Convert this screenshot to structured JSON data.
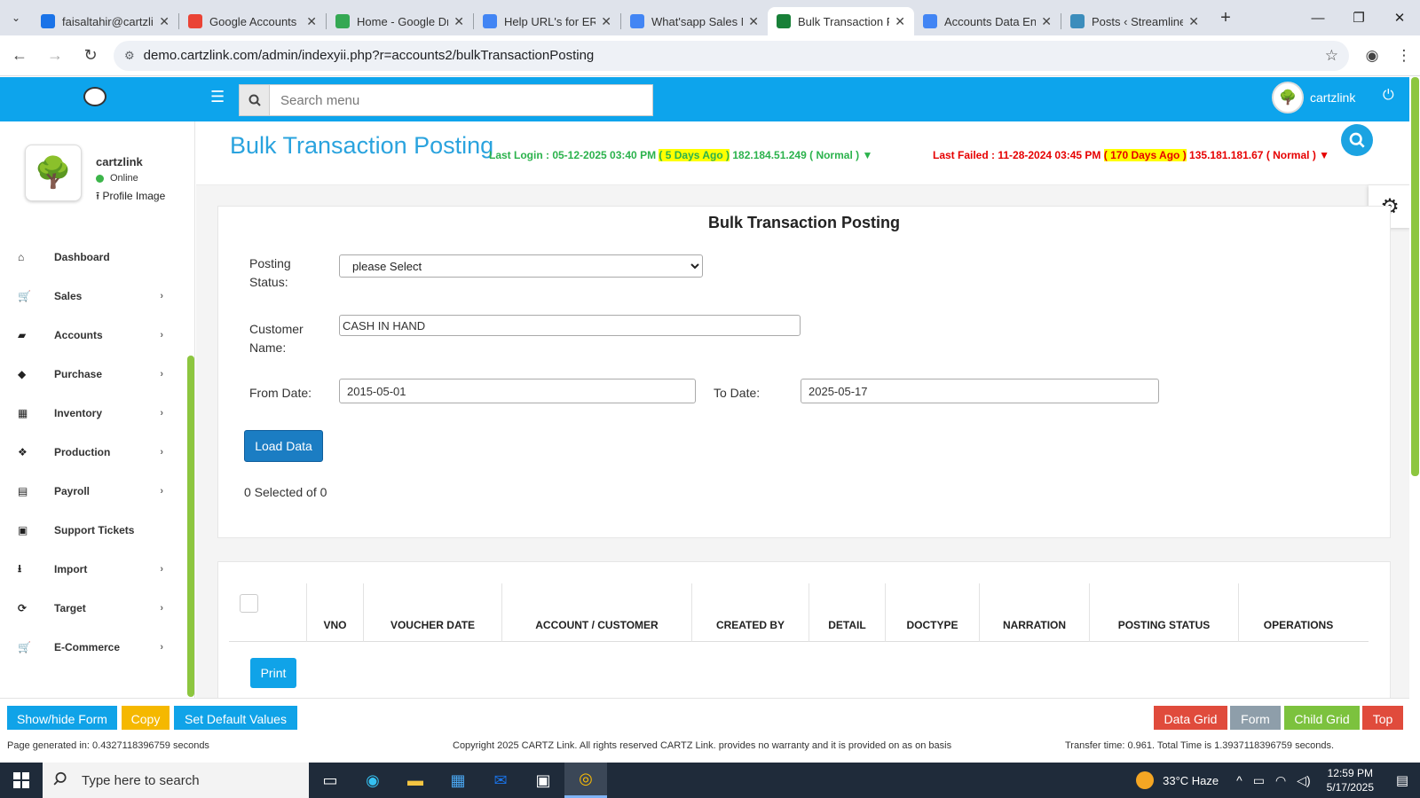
{
  "browser": {
    "tabs": [
      {
        "title": "faisaltahir@cartzli",
        "icon": "gmail-icon",
        "color": "#1a73e8"
      },
      {
        "title": "Google Accounts",
        "icon": "google-icon",
        "color": "#ea4335"
      },
      {
        "title": "Home - Google Dr",
        "icon": "drive-icon",
        "color": "#34a853"
      },
      {
        "title": "Help URL's for ERP",
        "icon": "docs-icon",
        "color": "#4285f4"
      },
      {
        "title": "What'sapp Sales M",
        "icon": "docs-icon",
        "color": "#4285f4"
      },
      {
        "title": "Bulk Transaction P",
        "icon": "sitemap-icon",
        "color": "#188038",
        "active": true
      },
      {
        "title": "Accounts Data Ent",
        "icon": "docs-icon",
        "color": "#4285f4"
      },
      {
        "title": "Posts ‹ Streamline",
        "icon": "wordpress-icon",
        "color": "#3c8dbc"
      }
    ],
    "url": "demo.cartzlink.com/admin/indexyii.php?r=accounts2/bulkTransactionPosting"
  },
  "header": {
    "search_placeholder": "Search menu",
    "username": "cartzlink"
  },
  "sidebar": {
    "profile_name": "cartzlink",
    "status": "Online",
    "profile_image_label": "Profile Image",
    "items": [
      {
        "label": "Dashboard",
        "icon": "home-icon",
        "has_children": false
      },
      {
        "label": "Sales",
        "icon": "cart-icon",
        "has_children": true
      },
      {
        "label": "Accounts",
        "icon": "briefcase-icon",
        "has_children": true
      },
      {
        "label": "Purchase",
        "icon": "tags-icon",
        "has_children": true
      },
      {
        "label": "Inventory",
        "icon": "grid-icon",
        "has_children": true
      },
      {
        "label": "Production",
        "icon": "cubes-icon",
        "has_children": true
      },
      {
        "label": "Payroll",
        "icon": "money-icon",
        "has_children": true
      },
      {
        "label": "Support Tickets",
        "icon": "ticket-icon",
        "has_children": false
      },
      {
        "label": "Import",
        "icon": "import-icon",
        "has_children": true
      },
      {
        "label": "Target",
        "icon": "refresh-icon",
        "has_children": true
      },
      {
        "label": "E-Commerce",
        "icon": "cart-icon",
        "has_children": true
      }
    ]
  },
  "page": {
    "title": "Bulk Transaction Posting",
    "last_login_prefix": "Last Login : 05-12-2025 03:40 PM",
    "last_login_ago": "( 5 Days Ago )",
    "last_login_ip": "182.184.51.249",
    "last_login_status": "( Normal ) ▼",
    "last_failed_prefix": "Last Failed : 11-28-2024 03:45 PM",
    "last_failed_ago": "( 170 Days Ago )",
    "last_failed_ip": "135.181.181.67",
    "last_failed_status": "( Normal ) ▼"
  },
  "form": {
    "title": "Bulk Transaction Posting",
    "posting_status_label_1": "Posting",
    "posting_status_label_2": "Status:",
    "posting_status_value": "please Select",
    "customer_label_1": "Customer",
    "customer_label_2": "Name:",
    "customer_value": "CASH IN HAND",
    "from_date_label": "From Date:",
    "from_date_value": "2015-05-01",
    "to_date_label": "To Date:",
    "to_date_value": "2025-05-17",
    "load_button": "Load Data",
    "selected_count": "0 Selected of 0"
  },
  "table": {
    "columns": [
      "VNO",
      "VOUCHER DATE",
      "ACCOUNT / CUSTOMER",
      "CREATED BY",
      "DETAIL",
      "DOCTYPE",
      "NARRATION",
      "POSTING STATUS",
      "OPERATIONS"
    ],
    "print_button": "Print"
  },
  "bottom_bar": {
    "show_hide": "Show/hide Form",
    "copy": "Copy",
    "set_default": "Set Default Values",
    "data_grid": "Data Grid",
    "form": "Form",
    "child_grid": "Child Grid",
    "top": "Top"
  },
  "footer": {
    "generated": "Page generated in: 0.4327118396759 seconds",
    "copyright": "Copyright 2025 CARTZ Link. All rights reserved CARTZ Link. provides no warranty and it is provided on as on basis",
    "transfer": "Transfer time: 0.961. Total Time is 1.3937118396759 seconds."
  },
  "taskbar": {
    "search_placeholder": "Type here to search",
    "weather": "33°C  Haze",
    "time": "12:59 PM",
    "date": "5/17/2025"
  },
  "colors": {
    "header": "#0da4ec",
    "accent_green": "#8dc63f",
    "title_blue": "#2aa3de"
  }
}
